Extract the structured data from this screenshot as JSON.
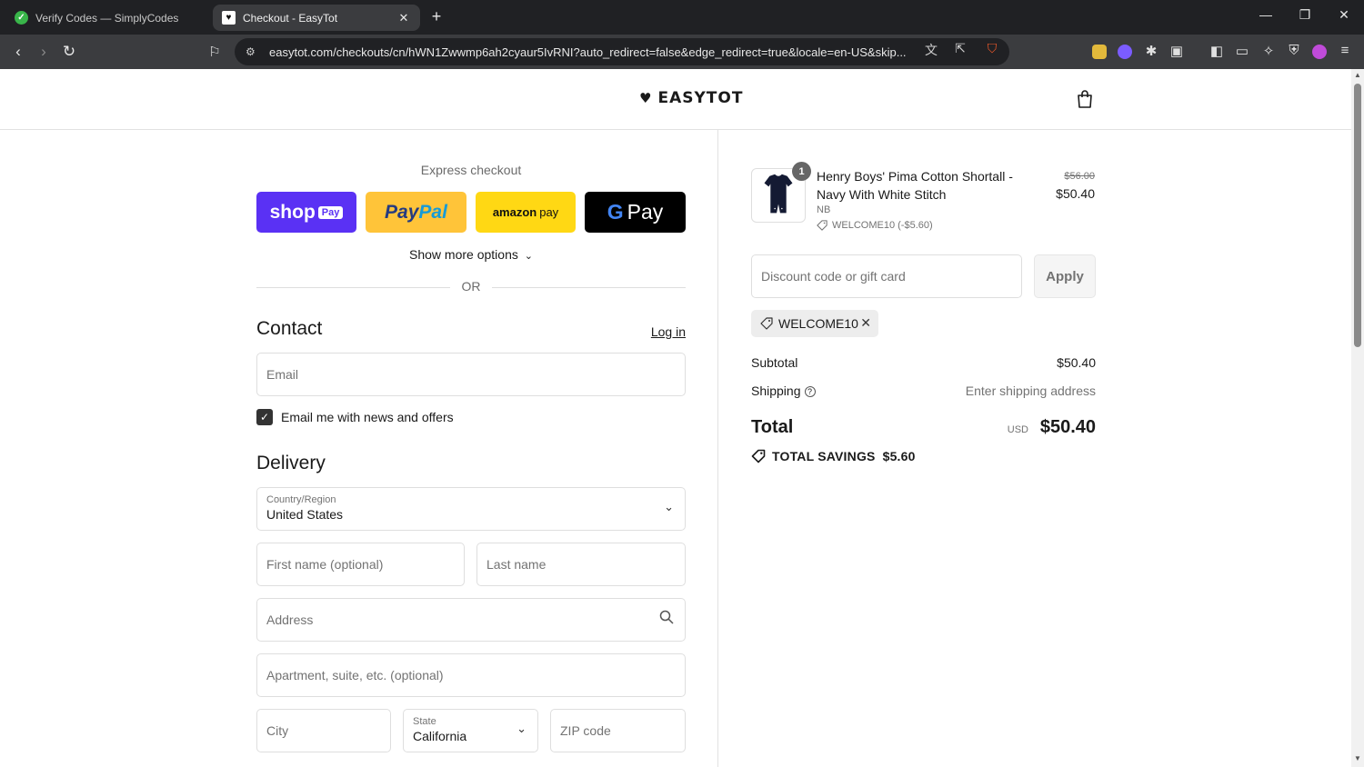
{
  "browser": {
    "tabs": [
      {
        "label": "Verify Codes — SimplyCodes",
        "favicon": "check-icon"
      },
      {
        "label": "Checkout - EasyTot",
        "favicon": "heart-icon"
      }
    ],
    "url": "easytot.com/checkouts/cn/hWN1Zwwmp6ah2cyaur5IvRNI?auto_redirect=false&edge_redirect=true&locale=en-US&skip..."
  },
  "header": {
    "brand": "EASYTOT"
  },
  "express": {
    "title": "Express checkout",
    "shop_label": "shop",
    "shop_pay_badge": "Pay",
    "paypal_a": "Pay",
    "paypal_b": "Pal",
    "amazon_a": "amazon",
    "amazon_b": "pay",
    "gpay_g": "G",
    "gpay_label": "Pay",
    "more_options": "Show more options",
    "or": "OR"
  },
  "contact": {
    "heading": "Contact",
    "login": "Log in",
    "email_placeholder": "Email",
    "newsletter_label": "Email me with news and offers",
    "newsletter_checked": true
  },
  "delivery": {
    "heading": "Delivery",
    "country_label": "Country/Region",
    "country_value": "United States",
    "first_name_placeholder": "First name (optional)",
    "last_name_placeholder": "Last name",
    "address_placeholder": "Address",
    "apartment_placeholder": "Apartment, suite, etc. (optional)",
    "city_placeholder": "City",
    "state_label": "State",
    "state_value": "California",
    "zip_placeholder": "ZIP code"
  },
  "summary": {
    "product": {
      "name": "Henry Boys' Pima Cotton Shortall - Navy With White Stitch",
      "variant": "NB",
      "discount": "WELCOME10 (-$5.60)",
      "original_price": "$56.00",
      "price": "$50.40",
      "quantity": "1"
    },
    "discount_placeholder": "Discount code or gift card",
    "apply_label": "Apply",
    "applied_code": "WELCOME10",
    "subtotal_label": "Subtotal",
    "subtotal_value": "$50.40",
    "shipping_label": "Shipping",
    "shipping_value": "Enter shipping address",
    "total_label": "Total",
    "currency": "USD",
    "total_value": "$50.40",
    "savings_label": "TOTAL SAVINGS",
    "savings_value": "$5.60"
  },
  "colors": {
    "shop_pay": "#5a31f4",
    "paypal": "#ffc439",
    "amazon_pay": "#ffd814",
    "google_pay": "#000000"
  }
}
